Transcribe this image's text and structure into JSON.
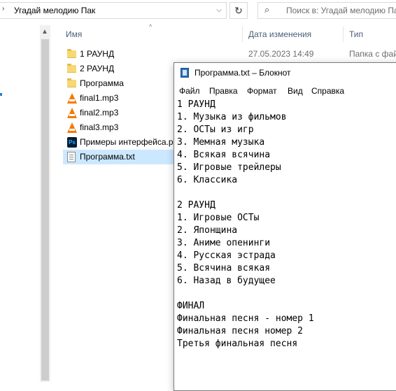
{
  "explorer": {
    "address_path": "Угадай мелодию Пак",
    "search_placeholder": "Поиск в: Угадай мелодию Пак",
    "columns": {
      "name": "Имя",
      "date": "Дата изменения",
      "type": "Тип"
    },
    "rows": [
      {
        "name": "1 РАУНД",
        "icon": "folder-icon",
        "date": "27.05.2023 14:49",
        "type": "Папка с фай"
      },
      {
        "name": "2 РАУНД",
        "icon": "folder-icon",
        "date": "",
        "type": ""
      },
      {
        "name": "Программа",
        "icon": "folder-icon",
        "date": "",
        "type": ""
      },
      {
        "name": "final1.mp3",
        "icon": "vlc-icon",
        "date": "",
        "type": ""
      },
      {
        "name": "final2.mp3",
        "icon": "vlc-icon",
        "date": "",
        "type": ""
      },
      {
        "name": "final3.mp3",
        "icon": "vlc-icon",
        "date": "",
        "type": ""
      },
      {
        "name": "Примеры интерфейса.p",
        "icon": "photoshop-icon",
        "date": "",
        "type": ""
      },
      {
        "name": "Программа.txt",
        "icon": "text-file-icon",
        "date": "",
        "type": "",
        "selected": true
      }
    ]
  },
  "notepad": {
    "title": "Программа.txt – Блокнот",
    "menu": [
      "Файл",
      "Правка",
      "Формат",
      "Вид",
      "Справка"
    ],
    "lines": [
      "1 РАУНД",
      "1. Музыка из фильмов",
      "2. ОСТы из игр",
      "3. Мемная музыка",
      "4. Всякая всячина",
      "5. Игровые трейлеры",
      "6. Классика",
      "",
      "2 РАУНД",
      "1. Игровые ОСТы",
      "2. Японщина",
      "3. Аниме опенинги",
      "4. Русская эстрада",
      "5. Всячина всякая",
      "6. Назад в будущее",
      "",
      "ФИНАЛ",
      "Финальная песня - номер 1",
      "Финальная песня номер 2",
      "Третья финальная песня"
    ]
  },
  "colors": {
    "selection": "#cce8ff",
    "header_text": "#4c607a",
    "folder": "#f8d775",
    "vlc": "#f47a00"
  }
}
